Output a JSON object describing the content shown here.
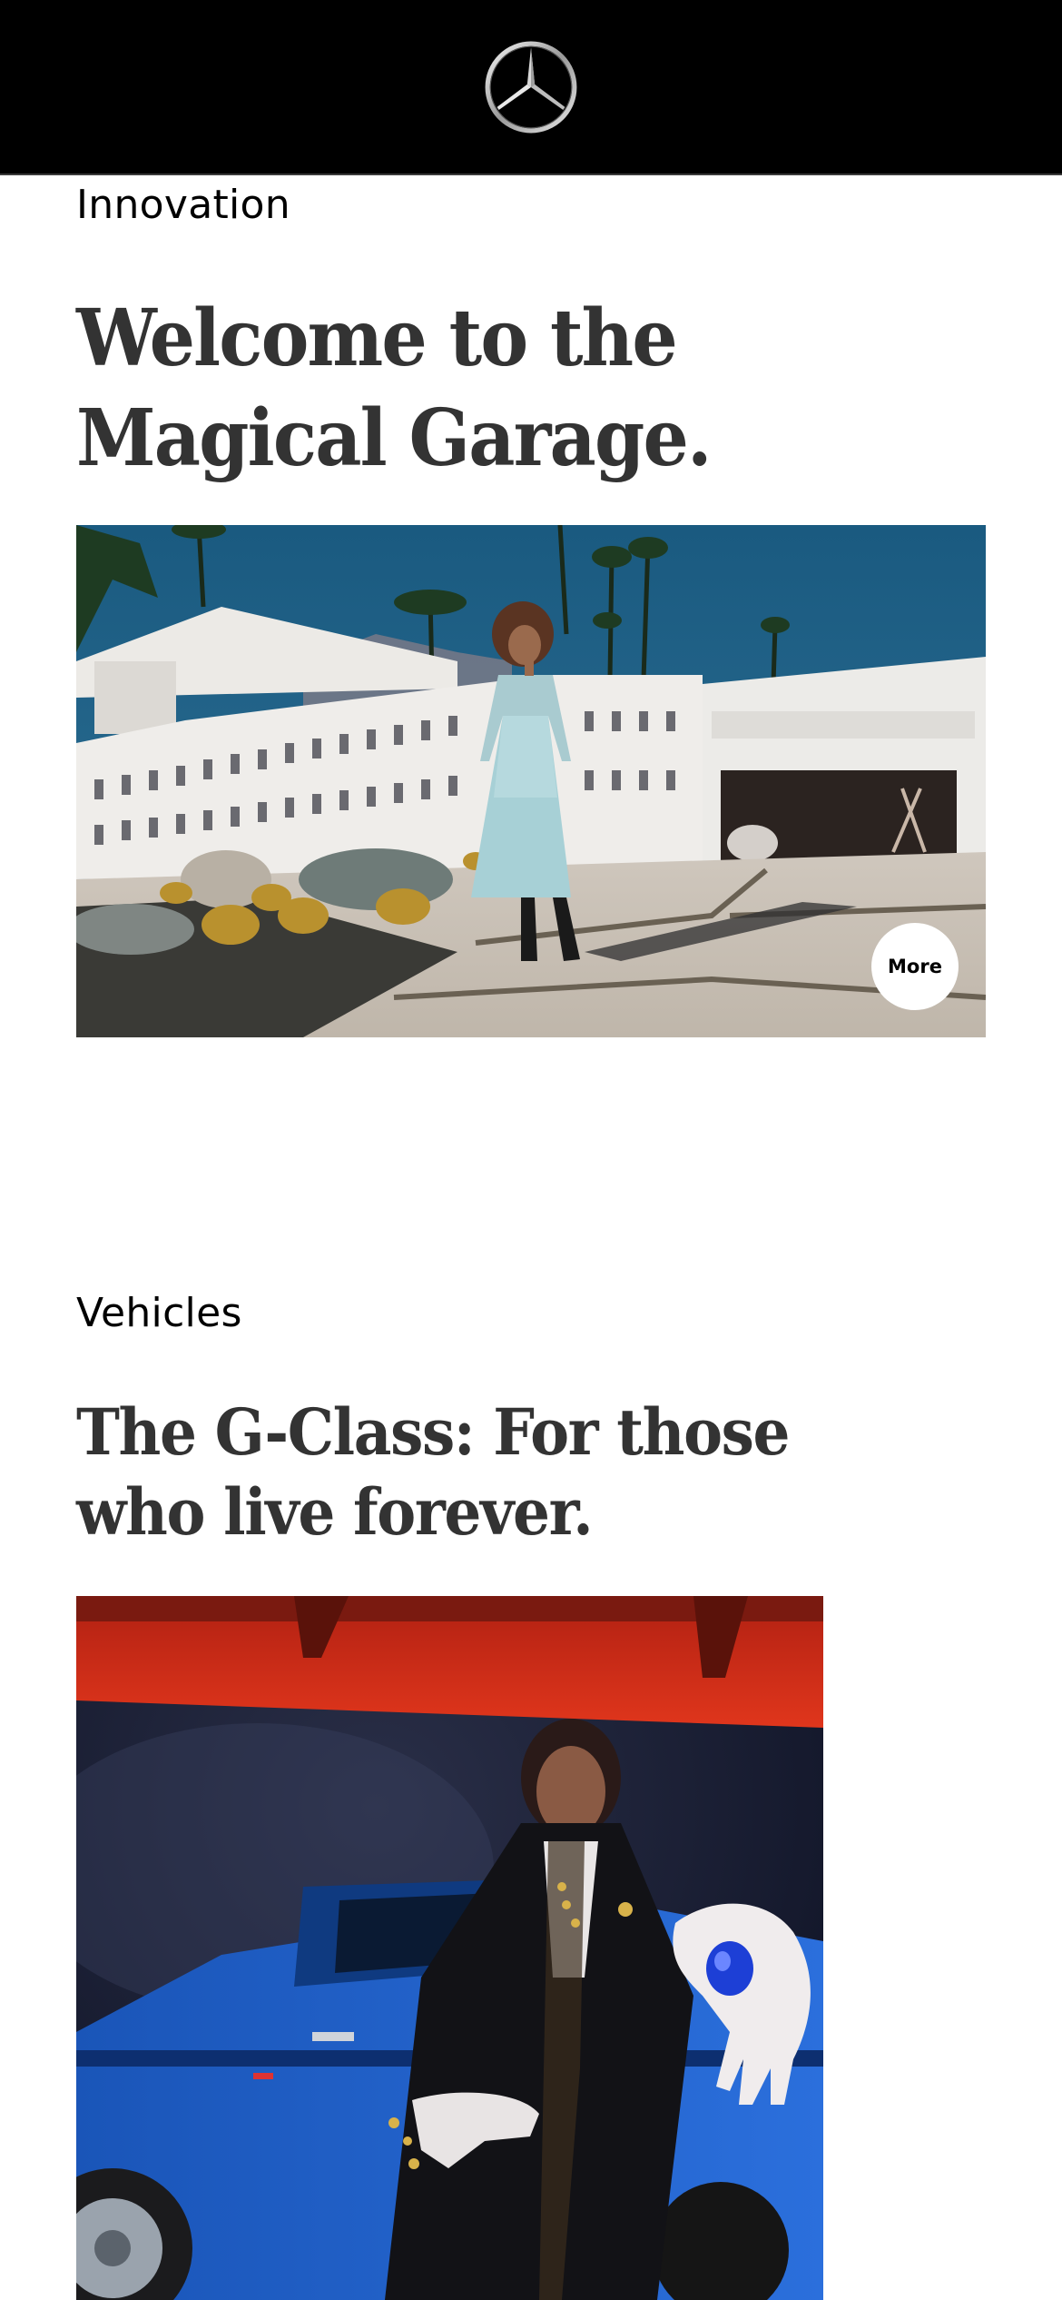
{
  "header": {
    "logo_icon": "mercedes-star-icon",
    "background": "#000000"
  },
  "sections": [
    {
      "label": "Innovation",
      "headline": "Welcome to the Magical Garage.",
      "image_desc_icon": "photo-woman-modernist-house",
      "more_label": "More"
    },
    {
      "label": "Vehicles",
      "headline": "The G-Class: For those who live forever.",
      "image_desc_icon": "photo-woman-blue-g-class"
    }
  ],
  "colors": {
    "headline": "#333333",
    "sky": "#1f5f86",
    "accent_red": "#d8301b",
    "vehicle_blue": "#1e5fc4"
  }
}
